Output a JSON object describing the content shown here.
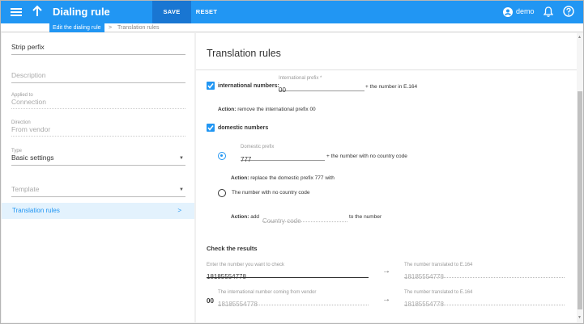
{
  "header": {
    "title": "Dialing rule",
    "save_label": "SAVE",
    "reset_label": "RESET",
    "user": "demo",
    "brand_color": "#2196f3"
  },
  "breadcrumb": {
    "current": "Edit the dialing rule",
    "sep": ">",
    "next": "Translation rules"
  },
  "sidebar": {
    "name": {
      "value": "Strip perfix"
    },
    "description": {
      "placeholder": "Description"
    },
    "applied_to": {
      "label": "Applied to",
      "value": "Connection"
    },
    "direction": {
      "label": "Direction",
      "value": "From vendor"
    },
    "type": {
      "label": "Type",
      "value": "Basic settings"
    },
    "template": {
      "placeholder": "Template"
    },
    "nav_item": "Translation rules",
    "nav_chev": ">"
  },
  "main": {
    "title": "Translation rules",
    "international": {
      "checkbox_label": "international numbers:",
      "prefix_label": "International prefix *",
      "prefix_value": "00",
      "suffix": "+ the number in E.164",
      "action_label": "Action:",
      "action_text": "remove the international prefix 00"
    },
    "domestic": {
      "checkbox_label": "domestic numbers",
      "prefix_label": "Domestic prefix",
      "prefix_value": "777",
      "suffix": "+ the number with no country code",
      "action_label": "Action:",
      "action_text": "replace the domestic prefix 777 with",
      "radio2_label": "The number with no country code",
      "add_label": "Action:",
      "add_word": "add",
      "country_placeholder": "Country code",
      "to_number": "to the number"
    },
    "check": {
      "title": "Check the results",
      "input_label": "Enter the number you want to check",
      "input_value": "18185554778",
      "result_label": "The number translated to E.164",
      "result_value": "18185554778",
      "vendor_label": "The international number coming from vendor",
      "vendor_prefix": "00",
      "vendor_value": "18185554778",
      "result2_label": "The number translated to E.164",
      "result2_value": "18185554778"
    }
  }
}
